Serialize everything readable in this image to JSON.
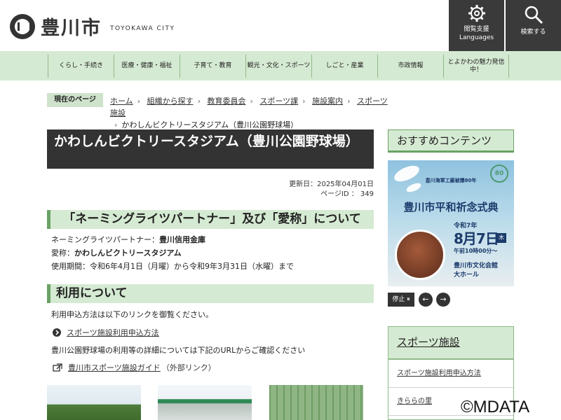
{
  "header": {
    "logo_jp": "豊川市",
    "logo_en": "TOYOKAWA CITY",
    "accessibility_label": "閲覧支援",
    "accessibility_sub": "Languages",
    "search_label": "検索する"
  },
  "nav": {
    "items": [
      {
        "label": "くらし・手続き"
      },
      {
        "label": "医療・健康・福祉"
      },
      {
        "label": "子育て・教育"
      },
      {
        "label": "観光・文化・スポーツ"
      },
      {
        "label": "しごと・産業"
      },
      {
        "label": "市政情報"
      },
      {
        "label": "とよかわの魅力発信中！"
      }
    ]
  },
  "breadcrumb": {
    "label": "現在のページ",
    "items": [
      "ホーム",
      "組織から探す",
      "教育委員会",
      "スポーツ課",
      "施設案内",
      "スポーツ施設"
    ],
    "current": "かわしんビクトリースタジアム（豊川公園野球場）"
  },
  "page": {
    "title": "かわしんビクトリースタジアム（豊川公園野球場）",
    "updated": "更新日：2025年04月01日",
    "page_id": "ページID ： 349"
  },
  "naming": {
    "heading": "「ネーミングライツパートナー」及び「愛称」について",
    "partner_label": "ネーミングライツパートナー：",
    "partner_value": "豊川信用金庫",
    "nickname_label": "愛称：",
    "nickname_value": "かわしんビクトリースタジアム",
    "period": "使用期間：令和6年4月1日（月曜）から令和9年3月31日（水曜）まで"
  },
  "usage": {
    "heading": "利用について",
    "intro": "利用申込方法は以下のリンクを御覧ください。",
    "link1": "スポーツ施設利用申込方法",
    "detail": "豊川公園野球場の利用等の詳細については下記のURLからご確認ください",
    "link2": "豊川市スポーツ施設ガイド",
    "link2_suffix": "（外部リンク）"
  },
  "sidebar": {
    "recommend_heading": "おすすめコンテンツ",
    "banner": {
      "head": "豊川海軍工廠被爆80年",
      "title": "豊川市平和祈念式典",
      "badge": "80",
      "date_era": "令和7年",
      "date_main": "8月7日",
      "date_day": "木",
      "time": "午前10時00分～",
      "venue1": "豊川市文化会館",
      "venue2": "大ホール"
    },
    "stop_label": "停止 ⏸",
    "prev_label": "←",
    "next_label": "→",
    "sports_heading": "スポーツ施設",
    "sports_links": [
      "スポーツ施設利用申込方法",
      "きららの里"
    ]
  },
  "copyright": "©MDATA"
}
